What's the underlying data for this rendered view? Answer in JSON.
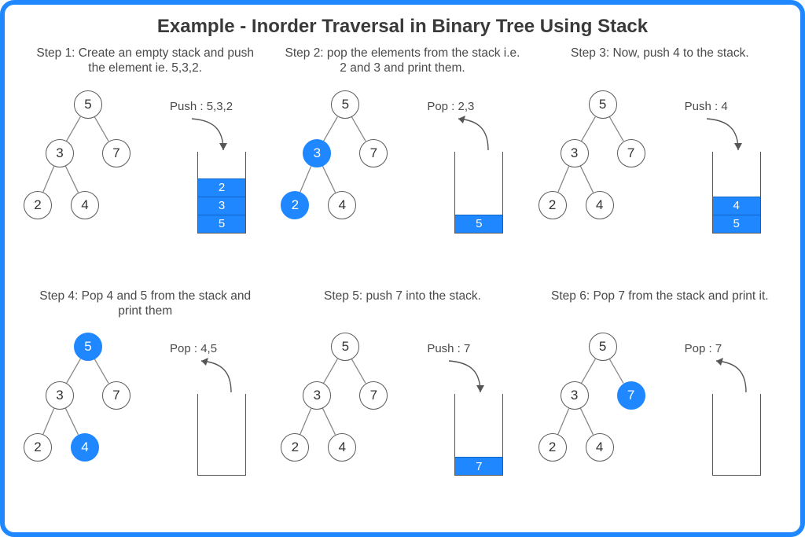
{
  "title": "Example - Inorder Traversal in Binary Tree Using Stack",
  "colors": {
    "accent": "#1f87ff"
  },
  "tree_nodes": [
    "5",
    "3",
    "7",
    "2",
    "4"
  ],
  "steps": [
    {
      "caption": "Step 1: Create an empty stack and push the element ie. 5,3,2.",
      "op_label": "Push : 5,3,2",
      "op_kind": "push",
      "highlight": [],
      "stack": [
        "5",
        "3",
        "2"
      ]
    },
    {
      "caption": "Step 2: pop the elements from the stack i.e. 2 and 3 and print them.",
      "op_label": "Pop : 2,3",
      "op_kind": "pop",
      "highlight": [
        "3",
        "2"
      ],
      "stack": [
        "5"
      ]
    },
    {
      "caption": "Step 3: Now, push 4 to the stack.",
      "op_label": "Push : 4",
      "op_kind": "push",
      "highlight": [],
      "stack": [
        "5",
        "4"
      ]
    },
    {
      "caption": "Step 4: Pop 4 and 5 from the stack and print them",
      "op_label": "Pop : 4,5",
      "op_kind": "pop",
      "highlight": [
        "5",
        "4"
      ],
      "stack": []
    },
    {
      "caption": "Step 5: push 7 into the stack.",
      "op_label": "Push : 7",
      "op_kind": "push",
      "highlight": [],
      "stack": [
        "7"
      ]
    },
    {
      "caption": "Step 6: Pop 7 from the stack and print it.",
      "op_label": "Pop : 7",
      "op_kind": "pop",
      "highlight": [
        "7"
      ],
      "stack": []
    }
  ]
}
